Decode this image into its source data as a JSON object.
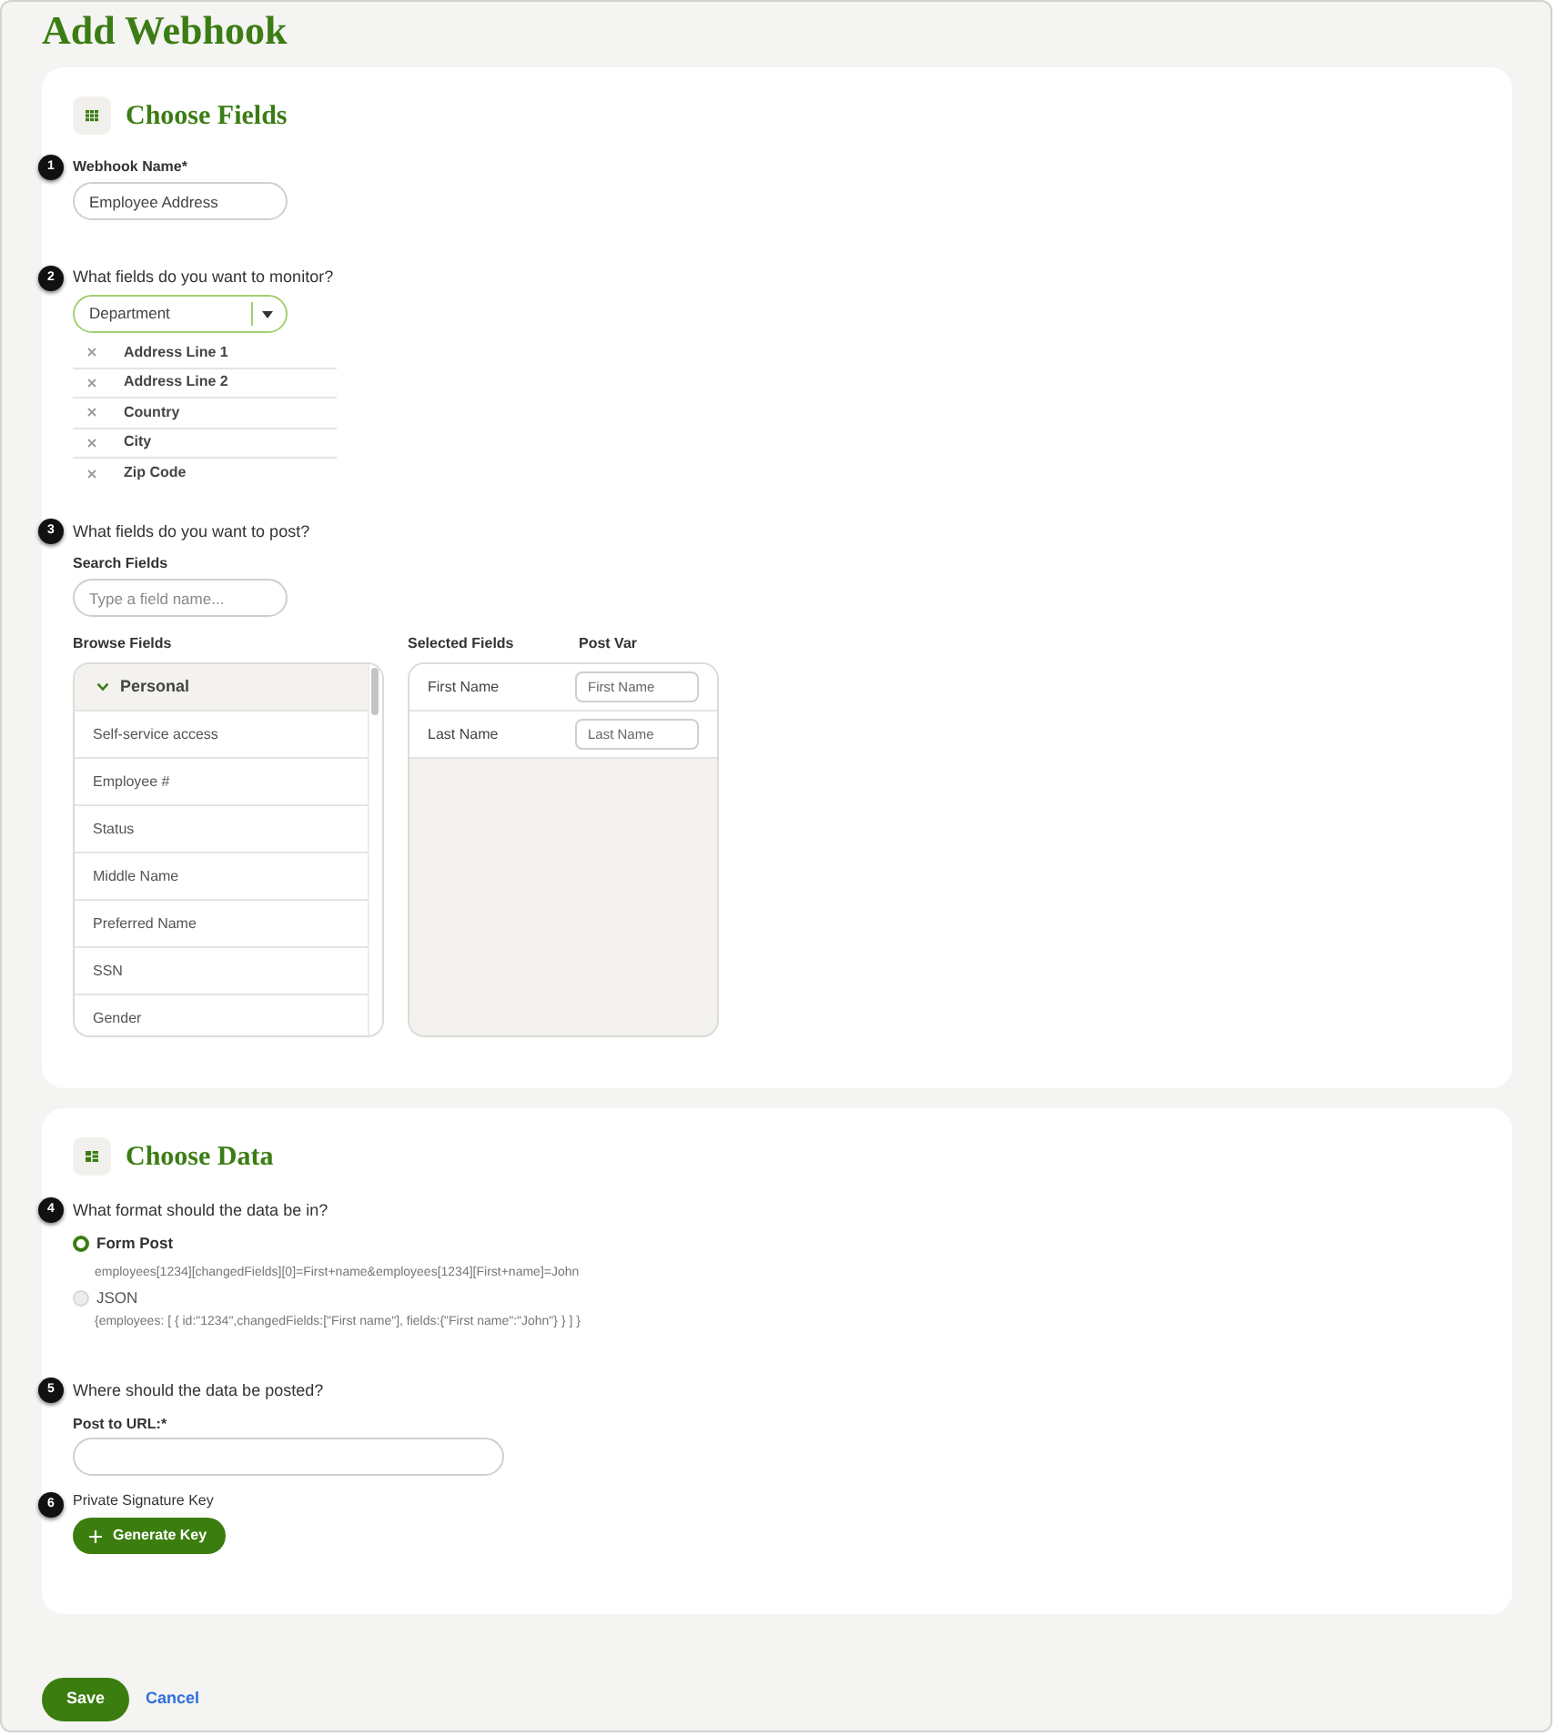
{
  "title": "Add Webhook",
  "choose_fields": {
    "heading": "Choose Fields",
    "webhook_name": {
      "step": "1",
      "label": "Webhook Name*",
      "value": "Employee Address"
    },
    "monitor": {
      "step": "2",
      "question": "What fields do you want to monitor?",
      "dropdown": {
        "value": "Department"
      },
      "monitored_fields": [
        "Address Line 1",
        "Address Line 2",
        "Country",
        "City",
        "Zip Code"
      ]
    },
    "post": {
      "step": "3",
      "question": "What fields do you want to post?",
      "search": {
        "label": "Search Fields",
        "placeholder": "Type a field name..."
      },
      "browse": {
        "label": "Browse Fields",
        "group": {
          "name": "Personal",
          "expanded": true
        },
        "items": [
          "Self-service access",
          "Employee #",
          "Status",
          "Middle Name",
          "Preferred Name",
          "SSN",
          "Gender"
        ]
      },
      "selected": {
        "columns": [
          "Selected Fields",
          "Post Var"
        ],
        "rows": [
          {
            "field": "First Name",
            "post_var": "First Name"
          },
          {
            "field": "Last Name",
            "post_var": "Last Name"
          }
        ]
      }
    }
  },
  "choose_data": {
    "heading": "Choose Data",
    "format": {
      "step": "4",
      "question": "What format should the data be in?",
      "options": [
        {
          "label": "Form Post",
          "selected": true,
          "example": "employees[1234][changedFields][0]=First+name&employees[1234][First+name]=John"
        },
        {
          "label": "JSON",
          "selected": false,
          "example": "{employees: [ { id:\"1234\",changedFields:[\"First name\"], fields:{\"First name\":\"John\"} } ] }"
        }
      ]
    },
    "destination": {
      "step": "5",
      "question": "Where should the data be posted?",
      "url": {
        "label": "Post to URL:*"
      }
    },
    "signature": {
      "step": "6",
      "label": "Private Signature Key",
      "button": "Generate Key"
    }
  },
  "actions": [
    {
      "kind": "primary",
      "label": "Save"
    },
    {
      "kind": "link",
      "label": "Cancel"
    }
  ]
}
